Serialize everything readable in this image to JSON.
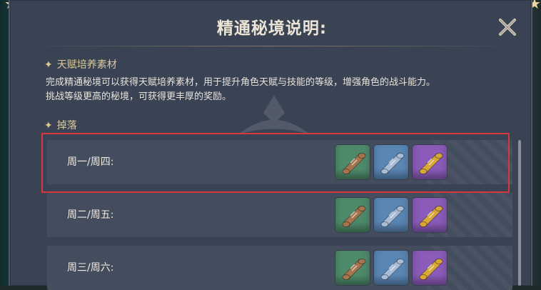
{
  "dialog": {
    "title": "精通秘境说明:",
    "close_icon": "close-x-icon"
  },
  "section_materials": {
    "header": "天赋培养素材",
    "description": [
      "完成精通秘境可以获得天赋培养素材，用于提升角色天赋与技能的等级，增强角色的战斗能力。",
      "挑战等级更高的秘境，可获得更丰厚的奖励。"
    ]
  },
  "section_drops": {
    "header": "掉落",
    "rows": [
      {
        "label": "周一/周四:",
        "highlighted": true
      },
      {
        "label": "周二/周五:",
        "highlighted": false
      },
      {
        "label": "周三/周六:",
        "highlighted": false
      }
    ]
  },
  "item_rarities": [
    {
      "name": "scroll-icon",
      "bg": "#4e8a6a",
      "scroll": "#a5754f"
    },
    {
      "name": "scroll-icon",
      "bg": "#5a86b4",
      "scroll": "#a9bdd6"
    },
    {
      "name": "scroll-icon",
      "bg": "#8a5bb8",
      "scroll": "#d7a737"
    }
  ],
  "colors": {
    "panel": "#3a4354",
    "row": "#444d5e",
    "highlight_border": "#d6363c",
    "section_header": "#d9c89b"
  }
}
